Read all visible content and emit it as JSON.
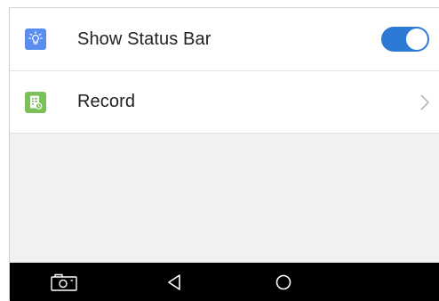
{
  "settings": {
    "items": [
      {
        "label": "Show Status Bar",
        "icon": "lightbulb-icon",
        "control": "toggle",
        "enabled": true
      },
      {
        "label": "Record",
        "icon": "record-document-icon",
        "control": "chevron"
      }
    ]
  },
  "colors": {
    "toggle_on": "#2c7ad6",
    "icon_blue": "#5a8def",
    "icon_green": "#7cc05a",
    "nav_bar": "#000000"
  },
  "nav_bar": {
    "buttons": [
      "screenshot-icon",
      "back-icon",
      "home-icon"
    ]
  }
}
